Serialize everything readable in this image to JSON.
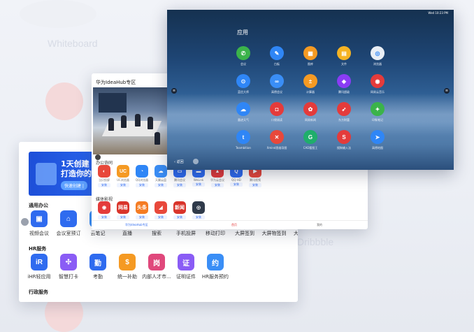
{
  "background": {
    "ghost_text_1": "Whiteboard",
    "ghost_text_2": "Dribbble"
  },
  "office": {
    "banner_line1": "1天创建",
    "banner_line2": "打造你的We",
    "banner_pill": "快速创建 |",
    "section1": "通用办公",
    "general_apps": [
      {
        "label": "视频会议",
        "color": "#2f6bef",
        "glyph": "▣",
        "icon": "video-icon"
      },
      {
        "label": "会议室预订",
        "color": "#2f6bef",
        "glyph": "⌂",
        "icon": "room-icon"
      },
      {
        "label": "云笔记",
        "color": "#3a8ef6",
        "glyph": "✎",
        "icon": "note-icon"
      },
      {
        "label": "直播",
        "color": "#e6602f",
        "glyph": "▶",
        "icon": "live-icon"
      },
      {
        "label": "搜索",
        "color": "#4c6ef5",
        "glyph": "⌕",
        "icon": "search-icon"
      },
      {
        "label": "手机投屏",
        "color": "#2f6bef",
        "glyph": "▭",
        "icon": "cast-icon"
      },
      {
        "label": "移动打印",
        "color": "#3a8ef6",
        "glyph": "⎙",
        "icon": "print-icon"
      },
      {
        "label": "大屏签到",
        "color": "#e43b3b",
        "glyph": "✓",
        "icon": "checkin-icon"
      },
      {
        "label": "大屏物签到",
        "color": "#e43b3b",
        "glyph": "✓",
        "icon": "checkin2-icon"
      },
      {
        "label": "大屏会讯",
        "color": "#2f6bef",
        "glyph": "◉",
        "icon": "news-icon"
      }
    ],
    "section2": "HR服务",
    "hr_apps": [
      {
        "label": "iHR轻应用",
        "color": "#2f6bef",
        "glyph": "iR",
        "icon": "ihr-icon"
      },
      {
        "label": "智慧打卡",
        "color": "#8a5cf5",
        "glyph": "✣",
        "icon": "punch-icon"
      },
      {
        "label": "考勤",
        "color": "#2f6bef",
        "glyph": "勤",
        "icon": "attendance-icon"
      },
      {
        "label": "统一补助",
        "color": "#f59a23",
        "glyph": "$",
        "icon": "subsidy-icon"
      },
      {
        "label": "内部人才市...",
        "color": "#e0487c",
        "glyph": "岗",
        "icon": "talent-icon"
      },
      {
        "label": "证明证件",
        "color": "#8a5cf5",
        "glyph": "证",
        "icon": "certificate-icon"
      },
      {
        "label": "HR服务预约",
        "color": "#3a8ef6",
        "glyph": "约",
        "icon": "booking-icon"
      }
    ],
    "section3": "行政服务"
  },
  "hub": {
    "title": "华为IdeaHub专区",
    "cat1": "办公协同",
    "office_apps": [
      {
        "name": "当贝投屏",
        "color": "#e8483b",
        "glyph": "◐",
        "icon": "screencast-icon"
      },
      {
        "name": "UC浏览器",
        "color": "#f59a23",
        "glyph": "UC",
        "icon": "uc-browser-icon"
      },
      {
        "name": "QQ浏览器",
        "color": "#2f86f6",
        "glyph": "◔",
        "icon": "qq-browser-icon"
      },
      {
        "name": "天翼云盘",
        "color": "#3a8ef6",
        "glyph": "☁",
        "icon": "cloud-disk-icon"
      },
      {
        "name": "腾讯会议",
        "color": "#2f6bef",
        "glyph": "▭",
        "icon": "meeting-icon"
      },
      {
        "name": "WeLink",
        "color": "#2f6bef",
        "glyph": "▬",
        "icon": "welink-icon"
      },
      {
        "name": "华为云会议",
        "color": "#e43b3b",
        "glyph": "▲",
        "icon": "cloud-meeting-icon"
      },
      {
        "name": "QQ HD",
        "color": "#2f6bef",
        "glyph": "Q",
        "icon": "qq-icon"
      },
      {
        "name": "腾讯视频",
        "color": "#e8483b",
        "glyph": "▶",
        "icon": "tencent-video-icon"
      }
    ],
    "install_label": "安装",
    "cat2": "媒体影视",
    "media_apps": [
      {
        "name": "",
        "color": "#e43b3b",
        "glyph": "◉",
        "icon": "netease-music-icon"
      },
      {
        "name": "",
        "color": "#d9342b",
        "glyph": "网易",
        "icon": "netease-news-icon"
      },
      {
        "name": "",
        "color": "#f57c23",
        "glyph": "头条",
        "icon": "toutiao-icon"
      },
      {
        "name": "",
        "color": "#e8483b",
        "glyph": "◢",
        "icon": "fox-video-icon"
      },
      {
        "name": "",
        "color": "#d9342b",
        "glyph": "新闻",
        "icon": "news-app-icon"
      },
      {
        "name": "",
        "color": "#2f3a4a",
        "glyph": "◎",
        "icon": "media-icon"
      }
    ],
    "tab_zone": "华为IdeaHub专区",
    "tab_home": "首页",
    "tab_mine": "我的"
  },
  "launcher": {
    "status_text": "Wed 10:23 PM",
    "title": "应用",
    "back_label": "返回",
    "apps": [
      {
        "name": "会议",
        "color": "#3bb34a",
        "glyph": "✆",
        "icon": "phone-icon"
      },
      {
        "name": "白板",
        "color": "#2f86f6",
        "glyph": "✎",
        "icon": "whiteboard-icon"
      },
      {
        "name": "图库",
        "color": "#f59a23",
        "glyph": "▦",
        "icon": "gallery-icon"
      },
      {
        "name": "文件",
        "color": "#f5b323",
        "glyph": "▤",
        "icon": "folder-icon"
      },
      {
        "name": "浏览器",
        "color": "#e9eef5",
        "glyph": "◎",
        "icon": "browser-icon"
      },
      {
        "name": "蓝信大师",
        "color": "#2f86f6",
        "glyph": "⊙",
        "icon": "bluexin-icon"
      },
      {
        "name": "高德会议",
        "color": "#3a8ef6",
        "glyph": "∞",
        "icon": "gaode-meeting-icon"
      },
      {
        "name": "计算器",
        "color": "#f59a23",
        "glyph": "±",
        "icon": "calculator-icon"
      },
      {
        "name": "腾讯超级",
        "color": "#8a3cf5",
        "glyph": "◈",
        "icon": "tencent-super-icon"
      },
      {
        "name": "网易云音乐",
        "color": "#e43b3b",
        "glyph": "◉",
        "icon": "cloud-music-icon"
      },
      {
        "name": "墨迹天气",
        "color": "#2f86f6",
        "glyph": "☁",
        "icon": "weather-icon"
      },
      {
        "name": "口袋阅读",
        "color": "#e43b3b",
        "glyph": "◘",
        "icon": "pocket-icon"
      },
      {
        "name": "网易新闻",
        "color": "#e43b3b",
        "glyph": "✿",
        "icon": "netease-icon"
      },
      {
        "name": "东方财富",
        "color": "#e43b3b",
        "glyph": "➶",
        "icon": "finance-icon"
      },
      {
        "name": "印象笔记",
        "color": "#3bb34a",
        "glyph": "✦",
        "icon": "evernote-icon"
      },
      {
        "name": "Teambition",
        "color": "#2f86f6",
        "glyph": "t",
        "icon": "teambition-icon"
      },
      {
        "name": "Xmind思维导图",
        "color": "#e8483b",
        "glyph": "✕",
        "icon": "xmind-icon"
      },
      {
        "name": "CAD看图王",
        "color": "#1fae6b",
        "glyph": "G",
        "icon": "cad-icon"
      },
      {
        "name": "搜狗输入法",
        "color": "#e43b3b",
        "glyph": "S",
        "icon": "sogou-icon"
      },
      {
        "name": "高德地图",
        "color": "#2f86f6",
        "glyph": "➤",
        "icon": "map-icon"
      }
    ]
  }
}
